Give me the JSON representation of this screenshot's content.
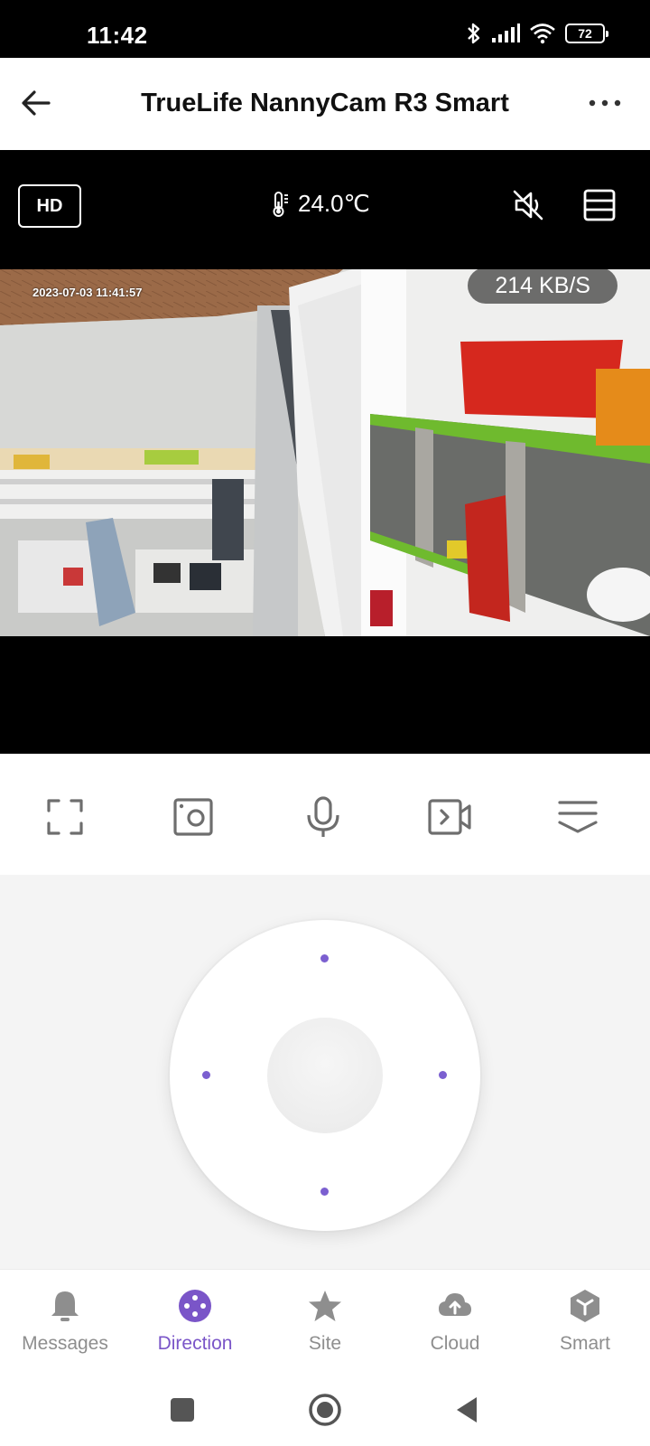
{
  "status_bar": {
    "time": "11:42",
    "battery_level": "72",
    "icons": [
      "bluetooth-icon",
      "signal-icon",
      "wifi-icon",
      "battery-icon"
    ]
  },
  "app_bar": {
    "title": "TrueLife NannyCam R3 Smart",
    "back_icon": "arrow-left-icon",
    "more_icon": "more-horizontal-icon"
  },
  "camera": {
    "quality_label": "HD",
    "temperature": "24.0℃",
    "timestamp": "2023-07-03 11:41:57",
    "bitrate": "214 KB/S",
    "controls": [
      "mute-icon",
      "layout-icon"
    ]
  },
  "toolbar": {
    "items": [
      "fullscreen-icon",
      "snapshot-icon",
      "microphone-icon",
      "record-video-icon",
      "collapse-icon"
    ]
  },
  "ptz": {
    "accent": "#7b5fd0"
  },
  "bottom_nav": {
    "items": [
      {
        "label": "Messages",
        "icon": "bell-icon",
        "active": false
      },
      {
        "label": "Direction",
        "icon": "direction-pad-icon",
        "active": true
      },
      {
        "label": "Site",
        "icon": "star-icon",
        "active": false
      },
      {
        "label": "Cloud",
        "icon": "cloud-upload-icon",
        "active": false
      },
      {
        "label": "Smart",
        "icon": "smart-cube-icon",
        "active": false
      }
    ],
    "active_color": "#7a55c8",
    "inactive_color": "#8e8e8e"
  },
  "system_nav": {
    "buttons": [
      "recents-square-icon",
      "home-circle-icon",
      "back-triangle-icon"
    ]
  }
}
